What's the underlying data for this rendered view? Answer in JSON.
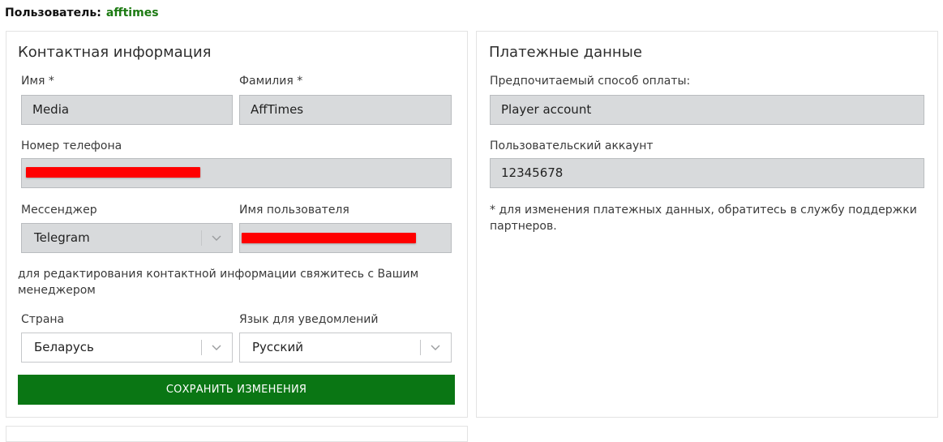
{
  "user": {
    "label": "Пользователь:",
    "name": "afftimes"
  },
  "contact": {
    "title": "Контактная информация",
    "first_name": {
      "label": "Имя *",
      "value": "Media"
    },
    "last_name": {
      "label": "Фамилия *",
      "value": "AffTimes"
    },
    "phone": {
      "label": "Номер телефона"
    },
    "messenger": {
      "label": "Мессенджер",
      "value": "Telegram"
    },
    "username": {
      "label": "Имя пользователя"
    },
    "note": "для редактирования контактной информации свяжитесь с Вашим менеджером",
    "country": {
      "label": "Страна",
      "value": "Беларусь"
    },
    "language": {
      "label": "Язык для уведомлений",
      "value": "Русский"
    },
    "save_label": "СОХРАНИТЬ ИЗМЕНЕНИЯ"
  },
  "payment": {
    "title": "Платежные данные",
    "method": {
      "label": "Предпочитаемый способ оплаты:",
      "value": "Player account"
    },
    "account": {
      "label": "Пользовательский аккаунт",
      "value": "12345678"
    },
    "note": "* для изменения платежных данных, обратитесь в службу поддержки партнеров."
  },
  "colors": {
    "accent": "#0a7614",
    "username": "#1c7a12",
    "redaction": "#ff0000",
    "field_bg": "#d8dadc"
  },
  "icons": {
    "select_arrow": "chevron-down-icon"
  }
}
